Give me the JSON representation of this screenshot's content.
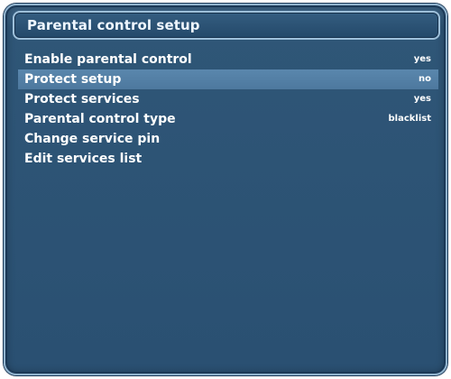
{
  "window": {
    "title": "Parental control setup"
  },
  "menu": {
    "items": [
      {
        "label": "Enable parental control",
        "value": "yes"
      },
      {
        "label": "Protect setup",
        "value": "no"
      },
      {
        "label": "Protect services",
        "value": "yes"
      },
      {
        "label": "Parental control type",
        "value": "blacklist"
      },
      {
        "label": "Change service pin"
      },
      {
        "label": "Edit services list"
      }
    ],
    "selected_index": 1
  },
  "colors": {
    "panel_bg": "#2a5072",
    "title_border": "#9ec0da",
    "highlight": "#4d789e",
    "text": "#ffffff"
  }
}
